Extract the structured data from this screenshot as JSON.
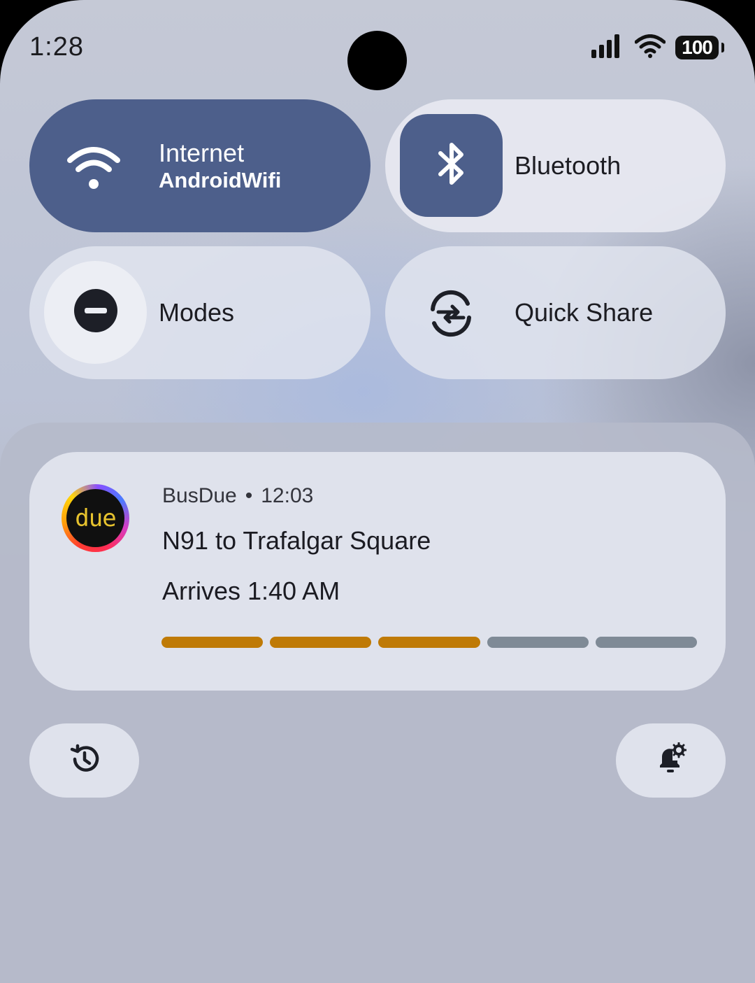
{
  "status_bar": {
    "time": "1:28",
    "battery": "100",
    "icons": [
      "signal-icon",
      "wifi-icon",
      "battery-icon"
    ]
  },
  "quick_settings": {
    "internet": {
      "title": "Internet",
      "subtitle": "AndroidWifi",
      "icon": "wifi-icon",
      "active": true
    },
    "bluetooth": {
      "title": "Bluetooth",
      "icon": "bluetooth-icon",
      "active": true
    },
    "modes": {
      "title": "Modes",
      "icon": "do-not-disturb-icon",
      "active": false
    },
    "quick_share": {
      "title": "Quick Share",
      "icon": "quick-share-icon",
      "active": false
    }
  },
  "notification": {
    "app_name": "BusDue",
    "separator": "•",
    "time": "12:03",
    "app_icon_text": "due",
    "title": "N91 to Trafalgar Square",
    "text": "Arrives 1:40 AM",
    "progress": {
      "segments": 5,
      "filled": 3
    }
  },
  "footer": {
    "history_icon": "history-icon",
    "notification_settings_icon": "notification-settings-icon"
  },
  "colors": {
    "active_tile": "#4d5f8b",
    "progress_filled": "#bf7a06",
    "progress_empty": "#7f8a96"
  }
}
